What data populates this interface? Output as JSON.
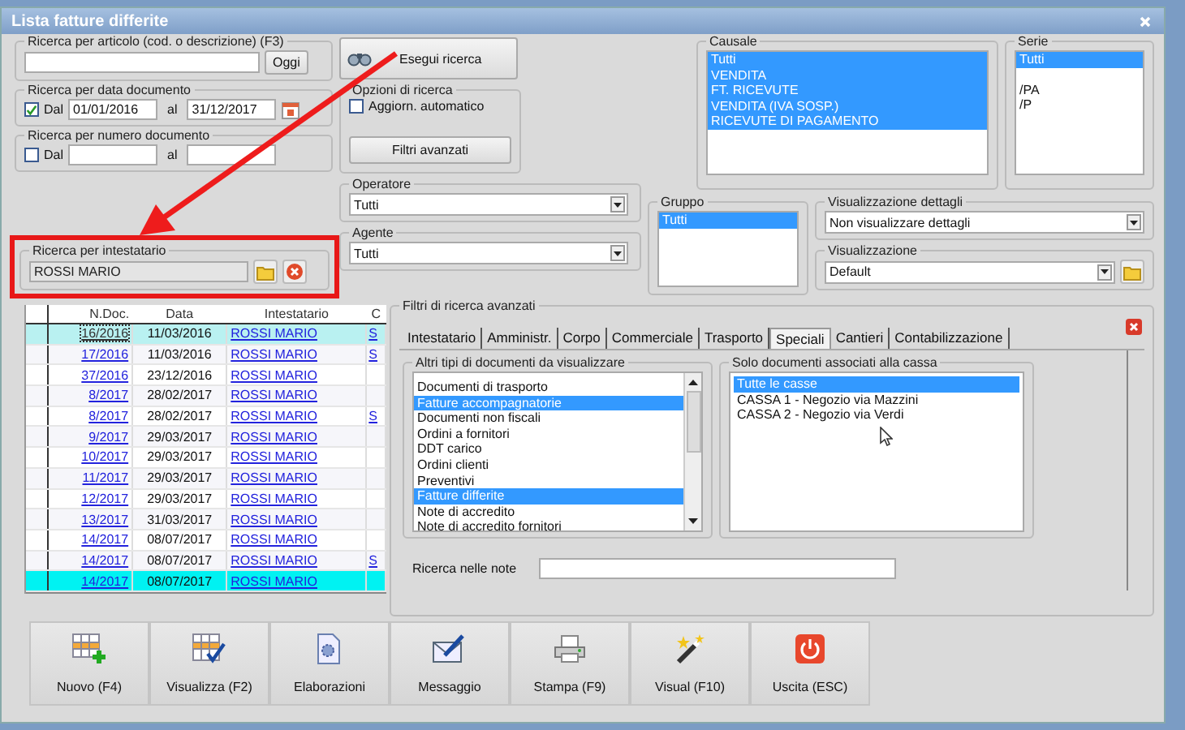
{
  "window": {
    "title": "Lista fatture differite"
  },
  "article_search": {
    "label": "Ricerca per articolo (cod. o descrizione) (F3)",
    "button": "Oggi"
  },
  "date_search": {
    "label": "Ricerca per data documento",
    "from_label": "Dal",
    "checked": true,
    "from": "01/01/2016",
    "to_label": "al",
    "to": "31/12/2017"
  },
  "number_search": {
    "label": "Ricerca per numero documento",
    "from_label": "Dal",
    "checked": false,
    "to_label": "al"
  },
  "run_search_button": "Esegui ricerca",
  "search_options": {
    "label": "Opzioni di ricerca",
    "auto_update": {
      "label": "Aggiorn. automatico",
      "checked": false
    },
    "advanced_button": "Filtri avanzati"
  },
  "holder_search": {
    "label": "Ricerca per intestatario",
    "value": "ROSSI MARIO"
  },
  "operatore": {
    "label": "Operatore",
    "value": "Tutti"
  },
  "agente": {
    "label": "Agente",
    "value": "Tutti"
  },
  "causale": {
    "label": "Causale",
    "items": [
      {
        "label": "Tutti",
        "selected": true
      },
      {
        "label": "VENDITA",
        "selected": true
      },
      {
        "label": "FT. RICEVUTE",
        "selected": true
      },
      {
        "label": "VENDITA (IVA SOSP.)",
        "selected": true
      },
      {
        "label": "RICEVUTE DI PAGAMENTO",
        "selected": true
      }
    ]
  },
  "serie": {
    "label": "Serie",
    "items": [
      {
        "label": "Tutti",
        "selected": true
      },
      {
        "label": "/PA",
        "selected": false
      },
      {
        "label": "/P",
        "selected": false
      }
    ]
  },
  "gruppo": {
    "label": "Gruppo",
    "items": [
      {
        "label": "Tutti",
        "selected": true
      }
    ]
  },
  "details_view": {
    "label": "Visualizzazione dettagli",
    "value": "Non visualizzare dettagli"
  },
  "view": {
    "label": "Visualizzazione",
    "value": "Default"
  },
  "table": {
    "columns": [
      "N.Doc.",
      "Data",
      "Intestatario",
      "C"
    ],
    "rows": [
      {
        "cells": [
          "16/2016",
          "11/03/2016",
          "ROSSI MARIO",
          "S"
        ],
        "focused": true,
        "selected": false
      },
      {
        "cells": [
          "17/2016",
          "11/03/2016",
          "ROSSI MARIO",
          "S"
        ],
        "focused": false,
        "selected": false
      },
      {
        "cells": [
          "37/2016",
          "23/12/2016",
          "ROSSI MARIO"
        ],
        "focused": false,
        "selected": false
      },
      {
        "cells": [
          "8/2017",
          "28/02/2017",
          "ROSSI MARIO"
        ],
        "focused": false,
        "selected": false
      },
      {
        "cells": [
          "8/2017",
          "28/02/2017",
          "ROSSI MARIO",
          "S"
        ],
        "focused": false,
        "selected": false
      },
      {
        "cells": [
          "9/2017",
          "29/03/2017",
          "ROSSI MARIO"
        ],
        "focused": false,
        "selected": false
      },
      {
        "cells": [
          "10/2017",
          "29/03/2017",
          "ROSSI MARIO"
        ],
        "focused": false,
        "selected": false
      },
      {
        "cells": [
          "11/2017",
          "29/03/2017",
          "ROSSI MARIO"
        ],
        "focused": false,
        "selected": false
      },
      {
        "cells": [
          "12/2017",
          "29/03/2017",
          "ROSSI MARIO"
        ],
        "focused": false,
        "selected": false
      },
      {
        "cells": [
          "13/2017",
          "31/03/2017",
          "ROSSI MARIO"
        ],
        "focused": false,
        "selected": false
      },
      {
        "cells": [
          "14/2017",
          "08/07/2017",
          "ROSSI MARIO"
        ],
        "focused": false,
        "selected": false
      },
      {
        "cells": [
          "14/2017",
          "08/07/2017",
          "ROSSI MARIO",
          "S"
        ],
        "focused": false,
        "selected": false
      },
      {
        "cells": [
          "14/2017",
          "08/07/2017",
          "ROSSI MARIO"
        ],
        "focused": false,
        "selected": true
      }
    ]
  },
  "advanced_filters": {
    "title": "Filtri di ricerca avanzati",
    "tabs": [
      {
        "label": "Intestatario",
        "selected": false
      },
      {
        "label": "Amministr.",
        "selected": false
      },
      {
        "label": "Corpo",
        "selected": false
      },
      {
        "label": "Commerciale",
        "selected": false
      },
      {
        "label": "Trasporto",
        "selected": false
      },
      {
        "label": "Speciali",
        "selected": true
      },
      {
        "label": "Cantieri",
        "selected": false
      },
      {
        "label": "Contabilizzazione",
        "selected": false
      }
    ],
    "doc_types": {
      "label": "Altri tipi di documenti da visualizzare",
      "items": [
        {
          "label": "Documenti di trasporto",
          "selected": false
        },
        {
          "label": "Fatture accompagnatorie",
          "selected": true
        },
        {
          "label": "Documenti non fiscali",
          "selected": false
        },
        {
          "label": "Ordini a fornitori",
          "selected": false
        },
        {
          "label": "DDT carico",
          "selected": false
        },
        {
          "label": "Ordini clienti",
          "selected": false
        },
        {
          "label": "Preventivi",
          "selected": false
        },
        {
          "label": "Fatture differite",
          "selected": true
        },
        {
          "label": "Note di accredito",
          "selected": false
        },
        {
          "label": "Note di accredito fornitori",
          "selected": false
        }
      ]
    },
    "cash": {
      "label": "Solo documenti associati alla cassa",
      "items": [
        {
          "label": "Tutte le casse",
          "selected": true
        },
        {
          "label": "CASSA 1 - Negozio via Mazzini",
          "selected": false
        },
        {
          "label": "CASSA 2 - Negozio via Verdi",
          "selected": false
        }
      ]
    },
    "notes": {
      "label": "Ricerca nelle note"
    }
  },
  "toolbar": [
    {
      "label": "Nuovo (F4)",
      "kind": "new"
    },
    {
      "label": "Visualizza (F2)",
      "kind": "view"
    },
    {
      "label": "Elaborazioni",
      "kind": "process"
    },
    {
      "label": "Messaggio",
      "kind": "message"
    },
    {
      "label": "Stampa (F9)",
      "kind": "print"
    },
    {
      "label": "Visual (F10)",
      "kind": "visual"
    },
    {
      "label": "Uscita (ESC)",
      "kind": "exit"
    }
  ]
}
